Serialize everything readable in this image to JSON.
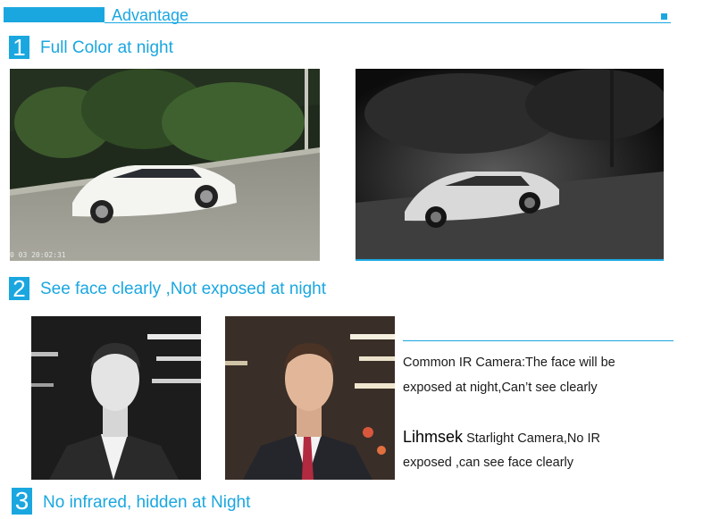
{
  "header": {
    "title": "Advantage",
    "accent_color": "#1aa7e0"
  },
  "sections": [
    {
      "number": "1",
      "title": "Full Color at night"
    },
    {
      "number": "2",
      "title": "See face clearly ,Not exposed at night"
    },
    {
      "number": "3",
      "title": "No infrared, hidden at Night"
    }
  ],
  "section1": {
    "color_photo_timestamp": "0 03 20:02:31"
  },
  "section2": {
    "ir_description": [
      "Common IR Camera:The face will be",
      "exposed at night,Can’t see clearly"
    ],
    "brand": "Lihmsek",
    "starlight_description_line1_rest": "Starlight Camera,No IR",
    "starlight_description_line2": "exposed ,can see face clearly"
  }
}
